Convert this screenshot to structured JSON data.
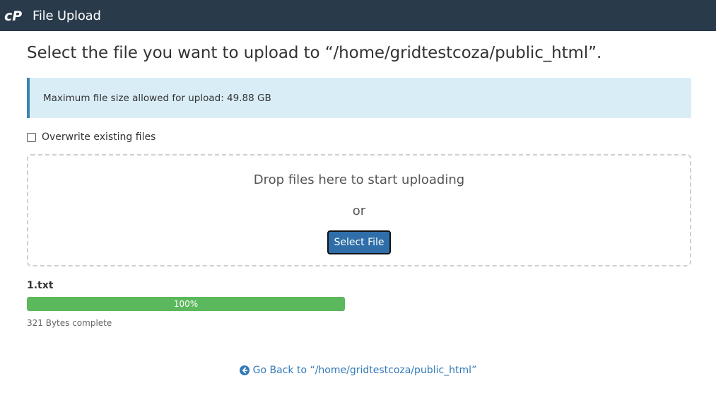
{
  "header": {
    "logo_icon": "cpanel-logo-icon",
    "title": "File Upload",
    "background": "#293a4a"
  },
  "main": {
    "heading": "Select the file you want to upload to “/home/gridtestcoza/public_html”.",
    "info": {
      "text": "Maximum file size allowed for upload: 49.88 GB",
      "background": "#d9edf7",
      "accent": "#3a87ad"
    },
    "overwrite": {
      "label": "Overwrite existing files",
      "checked": false
    },
    "dropzone": {
      "text": "Drop files here to start uploading",
      "or_text": "or",
      "button_label": "Select File",
      "button_color": "#2f6ea9"
    },
    "uploads": [
      {
        "file_name": "1.txt",
        "progress_percent": 100,
        "progress_label": "100%",
        "status": "321 Bytes complete",
        "bar_color": "#5cb85c"
      }
    ],
    "go_back": {
      "icon": "arrow-circle-left-icon",
      "label": "Go Back to “/home/gridtestcoza/public_html”",
      "color": "#337ab7"
    }
  }
}
